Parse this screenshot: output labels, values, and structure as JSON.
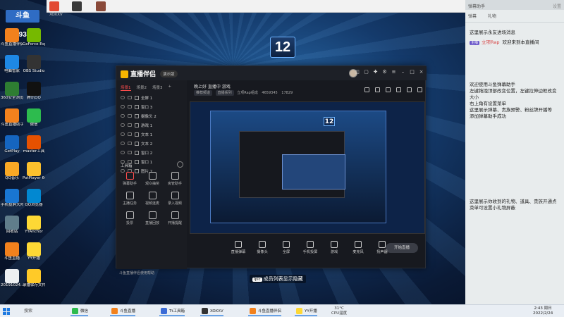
{
  "colors": {
    "accent_red": "#ff4d4d",
    "brand_yellow": "#f7b500",
    "chat_badge": "#6a57c9",
    "taskbar_bg": "#e9eef4",
    "chat_bg": "#e8eced"
  },
  "overlay": {
    "logo_text": "斗鱼",
    "room_id": "4659345",
    "score": "12",
    "caption_tag": "Ipic",
    "caption_text": "成员列表显示隐藏"
  },
  "browser_bar": {
    "url": "XOXXV"
  },
  "desktop_icons": [
    {
      "label": "斗鱼直播伴侣",
      "icon": "douyu-icon"
    },
    {
      "label": "GeForce Experience",
      "icon": "nvidia-icon"
    },
    {
      "label": "电脑管家",
      "icon": "shield-icon"
    },
    {
      "label": "OBS Studio",
      "icon": "obs-icon"
    },
    {
      "label": "360安全浏览器",
      "icon": "browser-icon"
    },
    {
      "label": "腾讯QQ",
      "icon": "qq-icon"
    },
    {
      "label": "斗鱼直播助手",
      "icon": "douyu-icon"
    },
    {
      "label": "微信",
      "icon": "wechat-icon"
    },
    {
      "label": "GetPlay",
      "icon": "play-icon"
    },
    {
      "label": "master工具",
      "icon": "tool-icon"
    },
    {
      "label": "QQ音乐",
      "icon": "music-icon"
    },
    {
      "label": "PotPlayer 64 bit",
      "icon": "potplayer-icon"
    },
    {
      "label": "手机投屏大师",
      "icon": "cast-icon"
    },
    {
      "label": "QQ浏览器",
      "icon": "qqbrowser-icon"
    },
    {
      "label": "回收站",
      "icon": "trash-icon"
    },
    {
      "label": "YYAnchor",
      "icon": "yy-icon"
    },
    {
      "label": "斗鱼直播",
      "icon": "douyu-icon"
    },
    {
      "label": "YY开播",
      "icon": "yy-icon"
    },
    {
      "label": "20191024...",
      "icon": "file-icon"
    },
    {
      "label": "录播保存文件夹",
      "icon": "folder-icon"
    }
  ],
  "app": {
    "title": "直播伴侣",
    "version": "演示版",
    "side_tabs": [
      "场景1",
      "场景2",
      "场景3"
    ],
    "layers": [
      {
        "name": "全屏 1",
        "type": "screen"
      },
      {
        "name": "窗口 3",
        "type": "window"
      },
      {
        "name": "摄像头 2",
        "type": "camera"
      },
      {
        "name": "游戏 1",
        "type": "game"
      },
      {
        "name": "文本 1",
        "type": "text"
      },
      {
        "name": "文本 2",
        "type": "text"
      },
      {
        "name": "窗口 2",
        "type": "window"
      },
      {
        "name": "窗口 1",
        "type": "window"
      },
      {
        "name": "图片 2",
        "type": "image"
      }
    ],
    "tools_title": "工具箱",
    "tools": [
      {
        "label": "弹幕助手",
        "icon": "barrage-icon"
      },
      {
        "label": "观众抽奖",
        "icon": "lottery-icon"
      },
      {
        "label": "房管助手",
        "icon": "admin-icon"
      },
      {
        "label": "主播任务",
        "icon": "task-icon"
      },
      {
        "label": "视频连麦",
        "icon": "video-link-icon"
      },
      {
        "label": "录入视频",
        "icon": "record-icon"
      },
      {
        "label": "投票",
        "icon": "vote-icon"
      },
      {
        "label": "直播回放",
        "icon": "replay-icon"
      },
      {
        "label": "开播提醒",
        "icon": "remind-icon"
      }
    ],
    "side_footer": "斗鱼直播伴侣使用帮助",
    "live_title": "晚上好 直播中 游戏",
    "live_tags": [
      "推荐频道",
      "直播系列"
    ],
    "live_stats": [
      "立项Rap组成",
      "4659345",
      "17829"
    ],
    "bottom_bar": [
      {
        "label": "直播弹幕",
        "icon": "barrage-icon"
      },
      {
        "label": "摄像头",
        "icon": "camera-icon"
      },
      {
        "label": "全屏",
        "icon": "screen-icon"
      },
      {
        "label": "手机投屏",
        "icon": "phone-cast-icon"
      },
      {
        "label": "游戏",
        "icon": "game-icon"
      },
      {
        "label": "麦克风",
        "icon": "mic-icon"
      },
      {
        "label": "扬声器",
        "icon": "speaker-icon"
      }
    ],
    "start_button": "开始直播"
  },
  "chat": {
    "header_left": "弹幕助手",
    "header_right": "设置",
    "tabs": [
      "弹幕",
      "礼物"
    ],
    "msg_welcome_note": "这里展示永友进场消息",
    "msg_badge": "主播",
    "msg_user": "立项Rap",
    "msg_text": "欢迎来到本直播间",
    "guide_lines": [
      "欢迎使用斗鱼弹幕助手",
      "左键拖拽顶部改变位置，左键拉伸边框改变大小",
      "右上角有设置菜单",
      "这里展示弹幕、贵族预警、粉丝牌开播等",
      "添加弹幕助手成功"
    ],
    "gift_note": "这里展示你收到的礼物、道具、贵族开通点菜单可设置小礼物屏蔽"
  },
  "taskbar": {
    "search": "搜索",
    "items": [
      "微信",
      "斗鱼直播",
      "Tt工具箱",
      "XOXXV",
      "斗鱼直播伴侣",
      "YY开播"
    ],
    "weather": "31°C",
    "weather_sub": "CPU温度",
    "clock_time": "2:43 周日",
    "clock_date": "2022/2/24"
  }
}
